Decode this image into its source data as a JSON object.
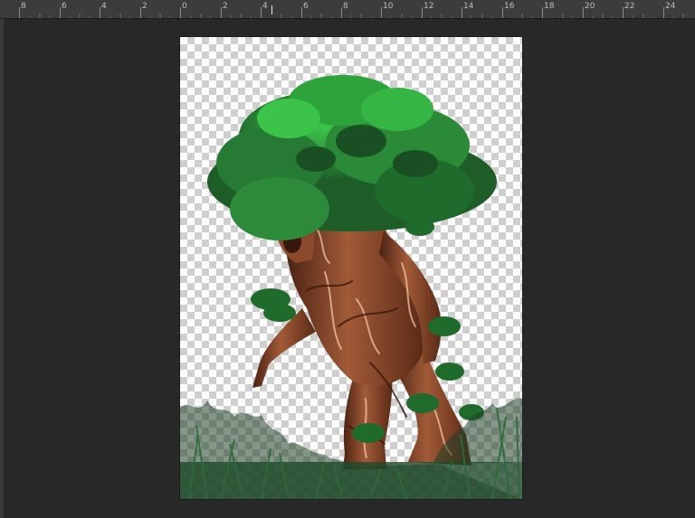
{
  "ruler": {
    "labels": [
      "8",
      "6",
      "4",
      "2",
      "0",
      "2",
      "4",
      "6",
      "8",
      "10",
      "12",
      "14",
      "16",
      "18",
      "20",
      "22",
      "24"
    ]
  },
  "canvas": {
    "artwork_icon": "tree-ent-illustration",
    "background": "transparency-checkerboard"
  },
  "colors": {
    "workspace": "#282828",
    "ruler": "#3c3c3c",
    "bark": "#8b4a2e",
    "bark_dark": "#4e2414",
    "foliage": "#2e8f3a",
    "foliage_light": "#3cc44a",
    "grass": "#1f4a2a"
  }
}
